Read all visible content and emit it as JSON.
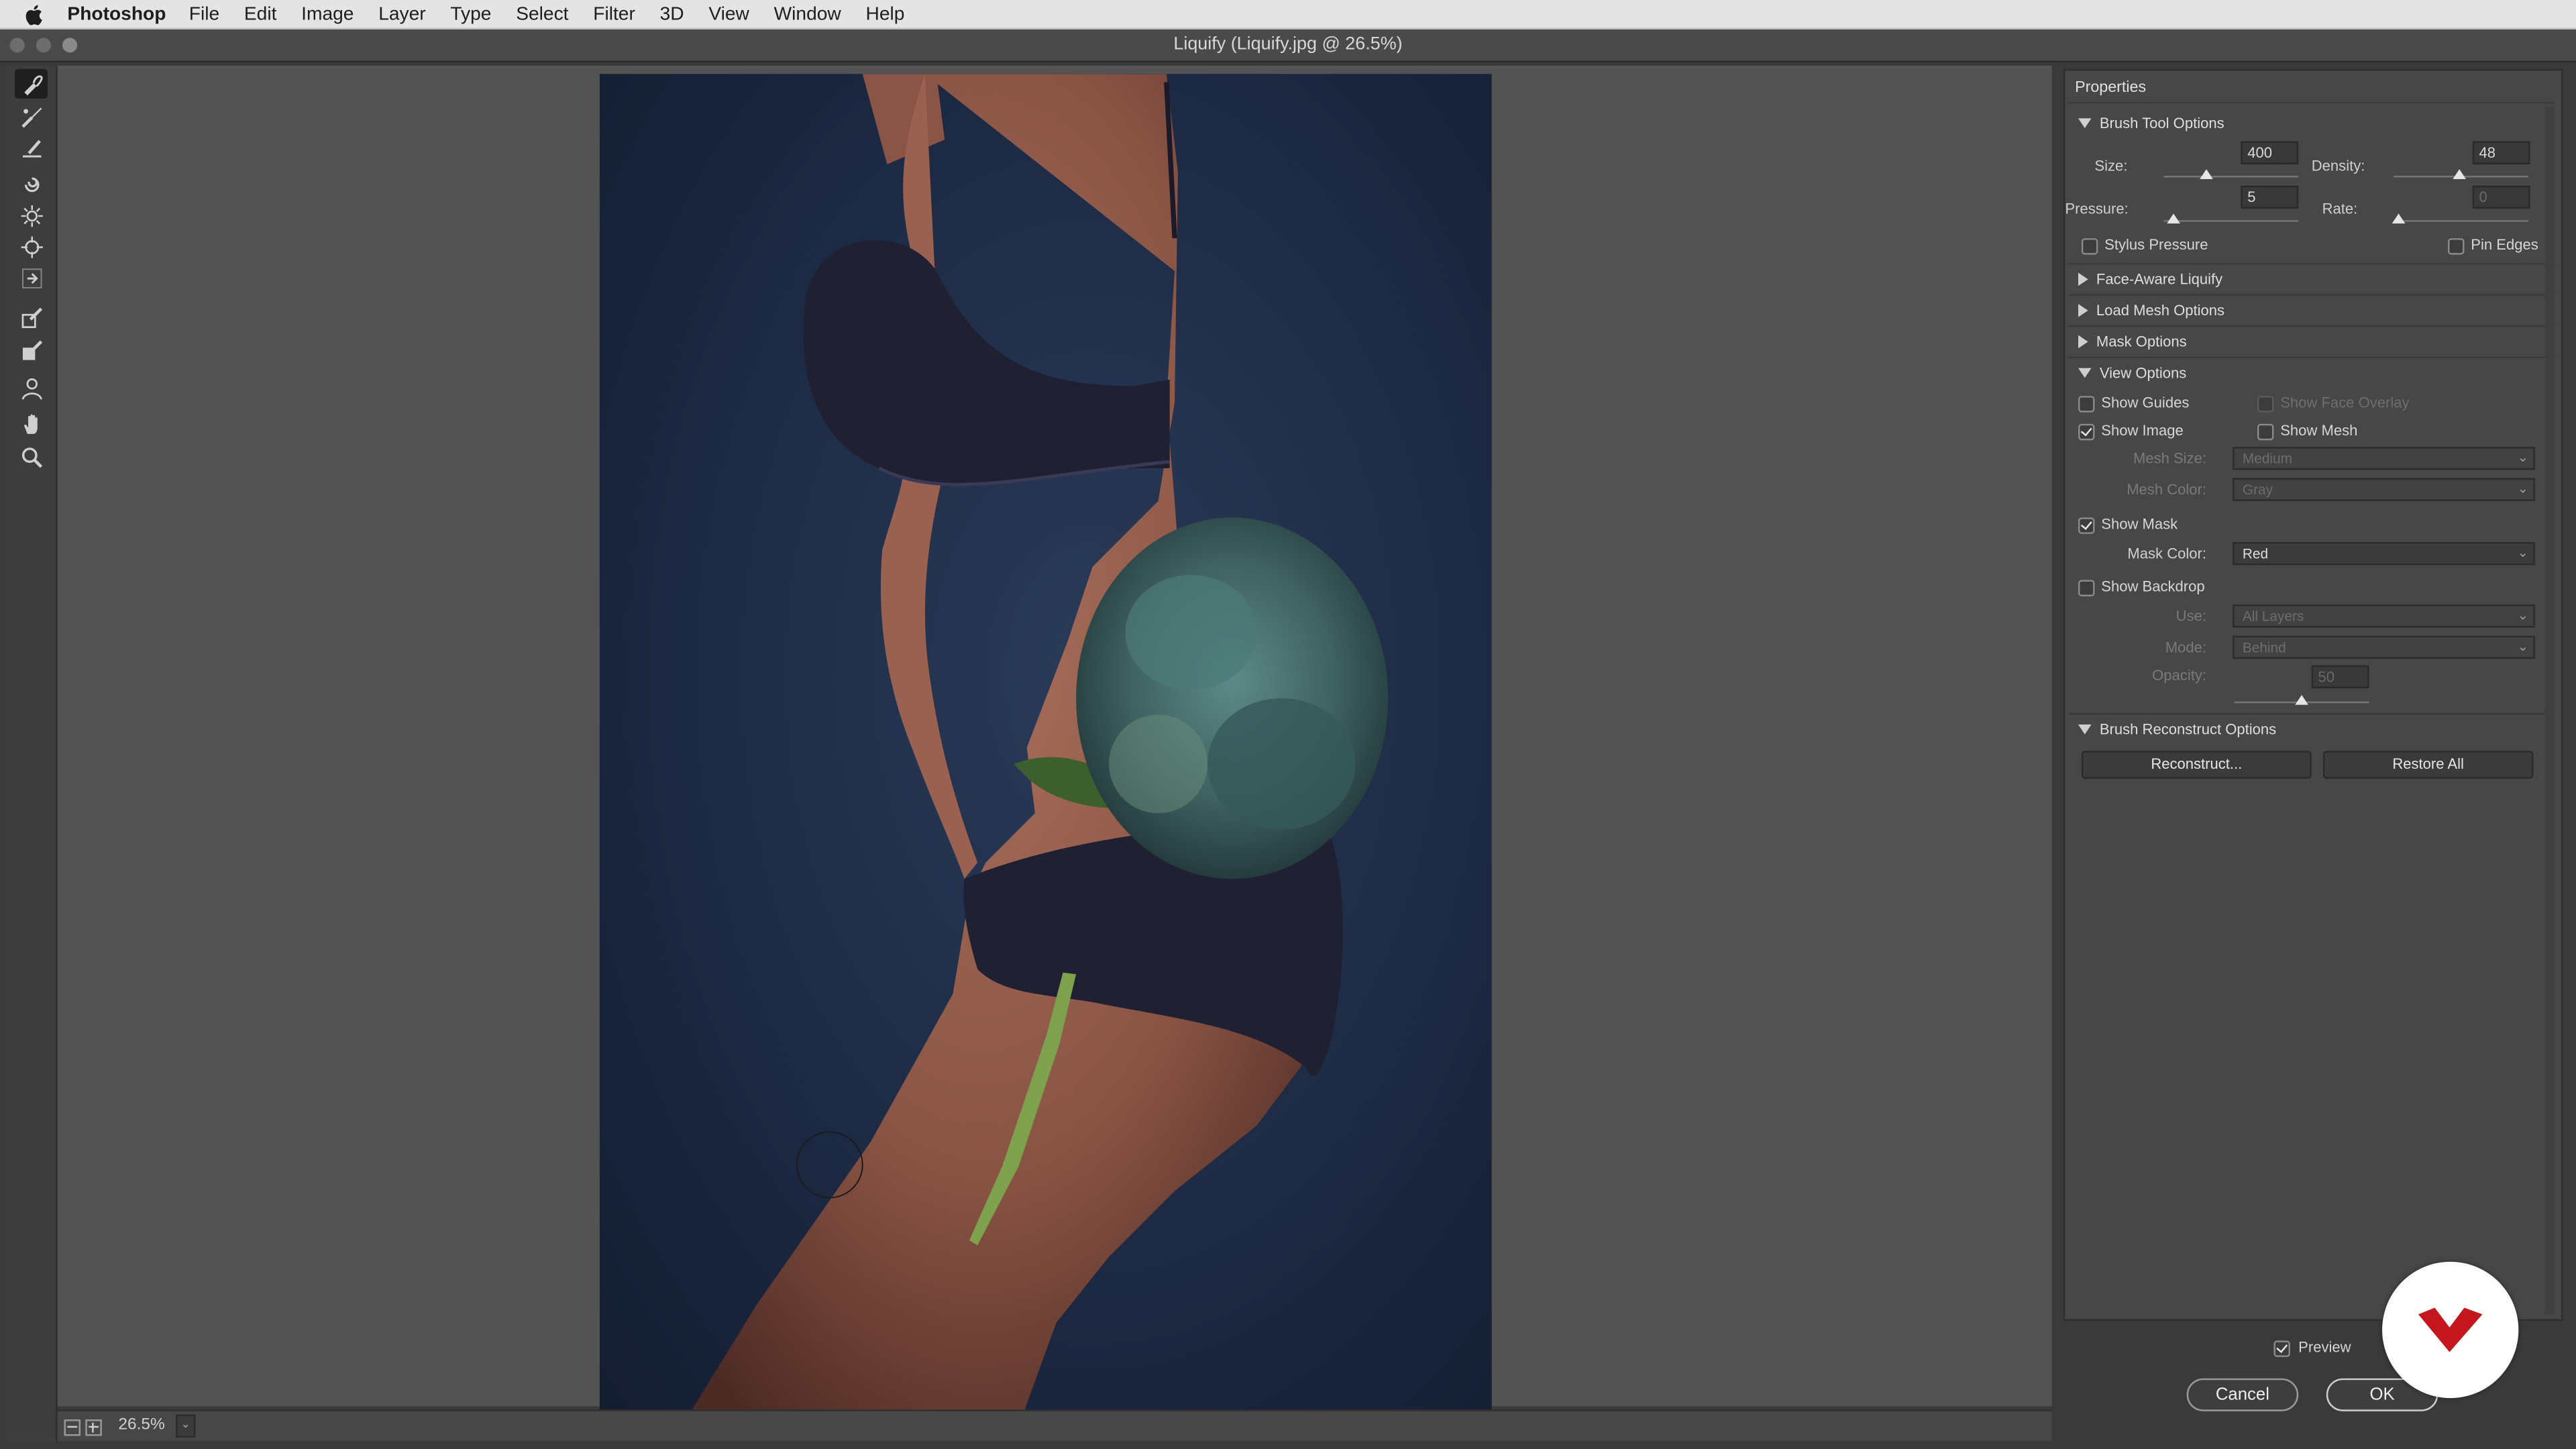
{
  "menubar": {
    "app_name": "Photoshop",
    "items": [
      "File",
      "Edit",
      "Image",
      "Layer",
      "Type",
      "Select",
      "Filter",
      "3D",
      "View",
      "Window",
      "Help"
    ]
  },
  "window": {
    "title": "Liquify (Liquify.jpg @ 26.5%)"
  },
  "tools": [
    {
      "icon": "forward-warp-icon"
    },
    {
      "icon": "reconstruct-icon"
    },
    {
      "icon": "smooth-icon"
    },
    {
      "icon": "twirl-icon"
    },
    {
      "icon": "pucker-icon"
    },
    {
      "icon": "bloat-icon"
    },
    {
      "icon": "push-left-icon"
    },
    {
      "icon": "freeze-mask-icon"
    },
    {
      "icon": "thaw-mask-icon"
    },
    {
      "icon": "face-tool-icon"
    },
    {
      "icon": "hand-icon"
    },
    {
      "icon": "zoom-icon"
    }
  ],
  "status": {
    "zoom": "26.5%"
  },
  "panel": {
    "header": "Properties",
    "brush_tool_options": {
      "title": "Brush Tool Options",
      "size_label": "Size:",
      "size": "400",
      "density_label": "Density:",
      "density": "48",
      "pressure_label": "Pressure:",
      "pressure": "5",
      "rate_label": "Rate:",
      "rate": "0",
      "stylus_pressure": "Stylus Pressure",
      "pin_edges": "Pin Edges"
    },
    "face_aware": "Face-Aware Liquify",
    "load_mesh": "Load Mesh Options",
    "mask_options": "Mask Options",
    "view_options": {
      "title": "View Options",
      "show_guides": "Show Guides",
      "show_face_overlay": "Show Face Overlay",
      "show_image": "Show Image",
      "show_mesh": "Show Mesh",
      "mesh_size_label": "Mesh Size:",
      "mesh_size": "Medium",
      "mesh_color_label": "Mesh Color:",
      "mesh_color": "Gray",
      "show_mask": "Show Mask",
      "mask_color_label": "Mask Color:",
      "mask_color": "Red",
      "show_backdrop": "Show Backdrop",
      "use_label": "Use:",
      "use": "All Layers",
      "mode_label": "Mode:",
      "mode": "Behind",
      "opacity_label": "Opacity:",
      "opacity": "50"
    },
    "brush_reconstruct": {
      "title": "Brush Reconstruct Options",
      "reconstruct": "Reconstruct...",
      "restore_all": "Restore All"
    }
  },
  "dialog": {
    "preview": "Preview",
    "cancel": "Cancel",
    "ok": "OK"
  },
  "colors": {
    "canvas_bg": "#535353",
    "panel_bg": "#474747",
    "logo_red": "#c4161c"
  }
}
